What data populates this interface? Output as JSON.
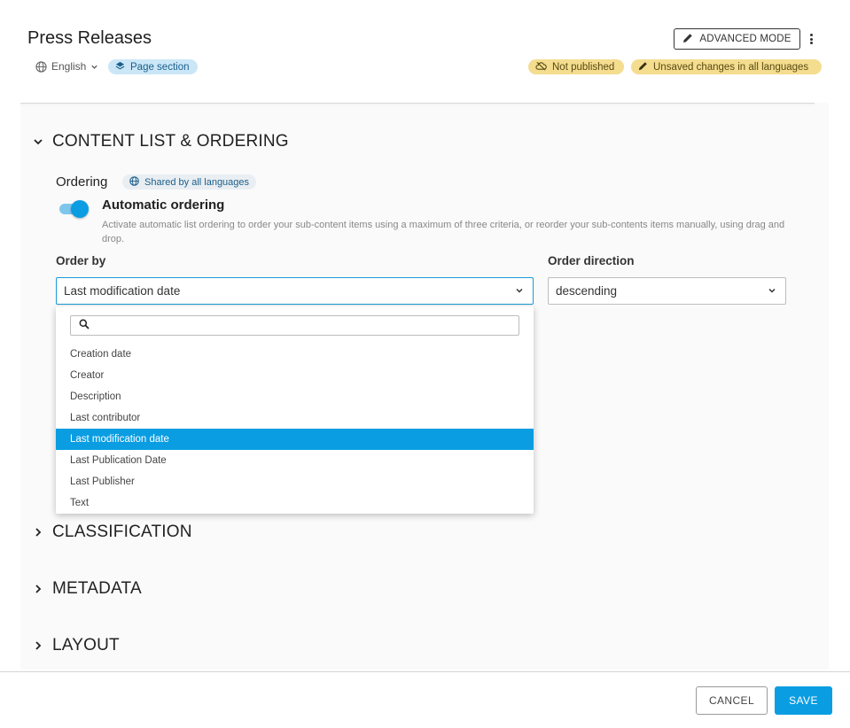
{
  "header": {
    "title": "Press Releases",
    "language": "English",
    "section_badge": "Page section",
    "advanced_mode": "ADVANCED MODE",
    "status_not_published": "Not published",
    "status_unsaved": "Unsaved changes in all languages"
  },
  "sections": {
    "content_list": "CONTENT LIST & ORDERING",
    "classification": "CLASSIFICATION",
    "metadata": "METADATA",
    "layout": "LAYOUT"
  },
  "ordering": {
    "label": "Ordering",
    "shared_badge": "Shared by all languages",
    "toggle_on": true,
    "auto_title": "Automatic ordering",
    "auto_desc": "Activate automatic list ordering to order your sub-content items using a maximum of three criteria, or reorder your sub-contents items manually, using drag and drop.",
    "order_by_label": "Order by",
    "order_by_value": "Last modification date",
    "order_direction_label": "Order direction",
    "order_direction_value": "descending"
  },
  "dropdown": {
    "search_value": "",
    "options": [
      "Creation date",
      "Creator",
      "Description",
      "Last contributor",
      "Last modification date",
      "Last Publication Date",
      "Last Publisher",
      "Text"
    ],
    "selected": "Last modification date"
  },
  "footer": {
    "cancel": "CANCEL",
    "save": "SAVE"
  },
  "colors": {
    "accent": "#0a9de2",
    "warning_badge": "#f4dd8f",
    "info_badge": "#cbe7f7"
  }
}
